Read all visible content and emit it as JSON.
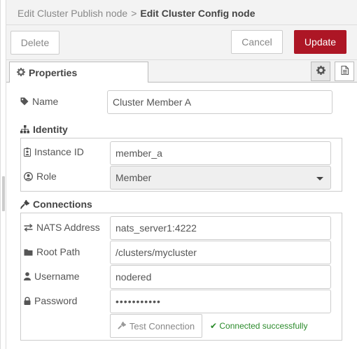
{
  "breadcrumb": {
    "parent": "Edit Cluster Publish node",
    "separator": ">",
    "current": "Edit Cluster Config node"
  },
  "toolbar": {
    "delete_label": "Delete",
    "cancel_label": "Cancel",
    "update_label": "Update"
  },
  "tabs": {
    "properties_label": "Properties"
  },
  "form": {
    "name_label": "Name",
    "name_value": "Cluster Member A",
    "identity": {
      "title": "Identity",
      "instance_id_label": "Instance ID",
      "instance_id_value": "member_a",
      "role_label": "Role",
      "role_value": "Member"
    },
    "connections": {
      "title": "Connections",
      "nats_label": "NATS Address",
      "nats_value": "nats_server1:4222",
      "root_path_label": "Root Path",
      "root_path_value": "/clusters/mycluster",
      "username_label": "Username",
      "username_value": "nodered",
      "password_label": "Password",
      "password_value": "•••••••••••",
      "test_button_label": "Test Connection",
      "status_text": "✔ Connected successfully"
    }
  },
  "colors": {
    "update_button": "#ad1625",
    "success": "#2a8a2a"
  }
}
